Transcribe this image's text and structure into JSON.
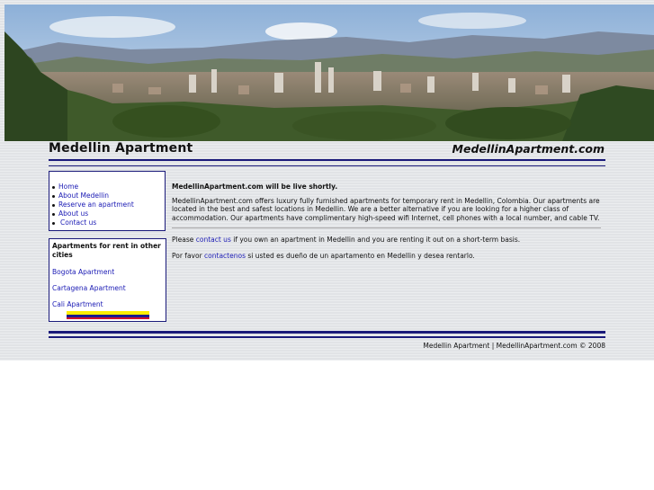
{
  "header": {
    "site_title": "Medellin Apartment",
    "site_domain": "MedellinApartment.com"
  },
  "nav": {
    "items": [
      {
        "label": "Home"
      },
      {
        "label": "About Medellin"
      },
      {
        "label": "Reserve an apartment"
      },
      {
        "label": "About us"
      },
      {
        "label": "Contact us"
      }
    ]
  },
  "sidebar": {
    "heading": "Apartments for rent in other cities",
    "links": [
      {
        "label": "Bogota Apartment"
      },
      {
        "label": "Cartagena Apartment"
      },
      {
        "label": "Cali Apartment"
      }
    ],
    "flag_colors": [
      "#ffee00",
      "#1a1a8c",
      "#cc1030"
    ]
  },
  "main": {
    "lead": "MedellinApartment.com will be live shortly.",
    "intro": "MedellinApartment.com offers luxury fully furnished apartments for temporary rent in Medellin, Colombia. Our apartments are located in the best and safest locations in Medellin. We are a better alternative if you are looking for a higher class of accommodation. Our apartments have complimentary high-speed wifi Internet, cell phones with a local number, and cable TV.",
    "contact_en": {
      "before": "Please ",
      "link": "contact us",
      "after": " if you own an apartment in Medellin and you are renting it out on a short-term basis."
    },
    "contact_es": {
      "before": "Por favor ",
      "link": "contactenos",
      "after": " si usted es dueño de un apartamento en Medellin y desea rentarlo."
    }
  },
  "footer": {
    "text": "Medellin Apartment | MedellinApartment.com © 2008"
  },
  "colors": {
    "rule": "#1a1a7a",
    "link": "#1a1ab4",
    "page_bg": "#e1e3e6"
  }
}
